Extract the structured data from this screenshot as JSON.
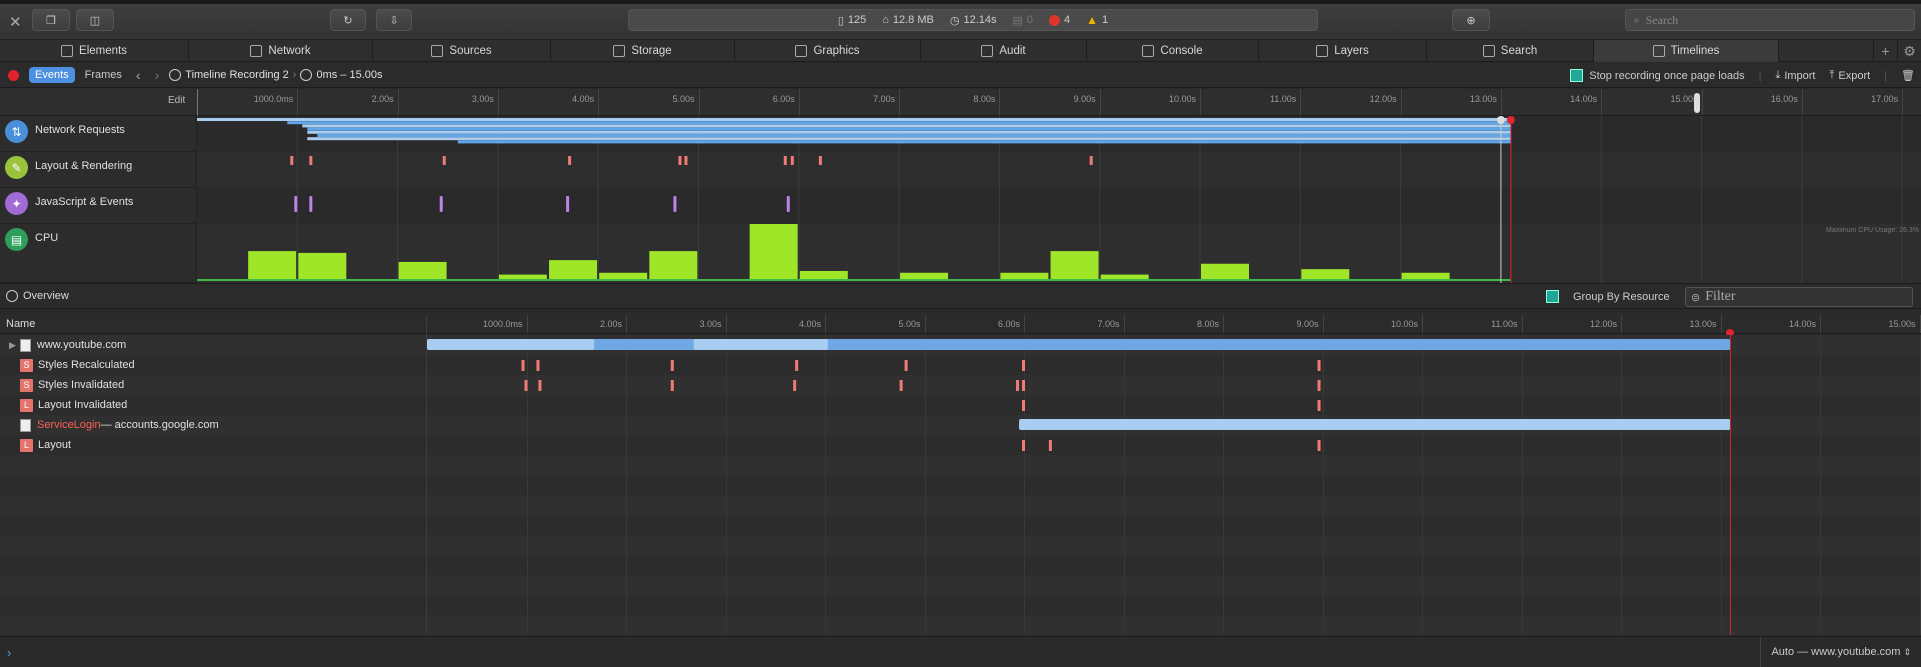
{
  "toolbar": {
    "close_icon": "close-icon",
    "resource_count": "125",
    "resource_size": "12.8 MB",
    "load_time": "12.14s",
    "log_count": "0",
    "error_count": "4",
    "warning_count": "1",
    "search_placeholder": "Search"
  },
  "tabs": [
    {
      "label": "Elements",
      "icon": "elements-icon"
    },
    {
      "label": "Network",
      "icon": "network-icon"
    },
    {
      "label": "Sources",
      "icon": "sources-icon"
    },
    {
      "label": "Storage",
      "icon": "storage-icon"
    },
    {
      "label": "Graphics",
      "icon": "graphics-icon"
    },
    {
      "label": "Audit",
      "icon": "audit-icon"
    },
    {
      "label": "Console",
      "icon": "console-icon"
    },
    {
      "label": "Layers",
      "icon": "layers-icon"
    },
    {
      "label": "Search",
      "icon": "search-icon"
    },
    {
      "label": "Timelines",
      "icon": "timelines-icon"
    }
  ],
  "subbar": {
    "events_label": "Events",
    "frames_label": "Frames",
    "recording_name": "Timeline Recording 2",
    "range": "0ms – 15.00s",
    "stop_recording_label": "Stop recording once page loads",
    "import_label": "Import",
    "export_label": "Export"
  },
  "overview_ruler": {
    "edit_label": "Edit",
    "ticks": [
      "1000.0ms",
      "2.00s",
      "3.00s",
      "4.00s",
      "5.00s",
      "6.00s",
      "7.00s",
      "8.00s",
      "9.00s",
      "10.00s",
      "11.00s",
      "12.00s",
      "13.00s",
      "14.00s",
      "15.00s",
      "16.00s",
      "17.00s"
    ]
  },
  "overview_tracks": [
    {
      "label": "Network Requests",
      "color": "#4a8fd9"
    },
    {
      "label": "Layout & Rendering",
      "color": "#9bc23c"
    },
    {
      "label": "JavaScript & Events",
      "color": "#a06bd4"
    },
    {
      "label": "CPU",
      "color": "#2f9e5a"
    }
  ],
  "cpu_note": "Maximum CPU Usage: 26.3%",
  "cpu_levels": [
    0,
    0.32,
    0.3,
    0,
    0.2,
    0,
    0.06,
    0.22,
    0.08,
    0.32,
    0,
    0.62,
    0.1,
    0,
    0.08,
    0,
    0.08,
    0.32,
    0.06,
    0,
    0.18,
    0,
    0.12,
    0,
    0.08,
    0
  ],
  "overview_section": {
    "label": "Overview",
    "group_by_resource_label": "Group By Resource",
    "filter_placeholder": "Filter"
  },
  "details": {
    "name_header": "Name",
    "ticks": [
      "1000.0ms",
      "2.00s",
      "3.00s",
      "4.00s",
      "5.00s",
      "6.00s",
      "7.00s",
      "8.00s",
      "9.00s",
      "10.00s",
      "11.00s",
      "12.00s",
      "13.00s",
      "14.00s",
      "15.00s"
    ],
    "rows": [
      {
        "label": "www.youtube.com",
        "badge": "",
        "kind": "doc"
      },
      {
        "label": "Styles Recalculated",
        "badge": "S",
        "kind": "style"
      },
      {
        "label": "Styles Invalidated",
        "badge": "S",
        "kind": "style"
      },
      {
        "label": "Layout Invalidated",
        "badge": "L",
        "kind": "layout"
      },
      {
        "label": "ServiceLogin",
        "sublabel": " — accounts.google.com",
        "badge": "",
        "kind": "doc"
      },
      {
        "label": "Layout",
        "badge": "L",
        "kind": "layout"
      }
    ]
  },
  "console": {
    "context": "Auto — www.youtube.com"
  }
}
